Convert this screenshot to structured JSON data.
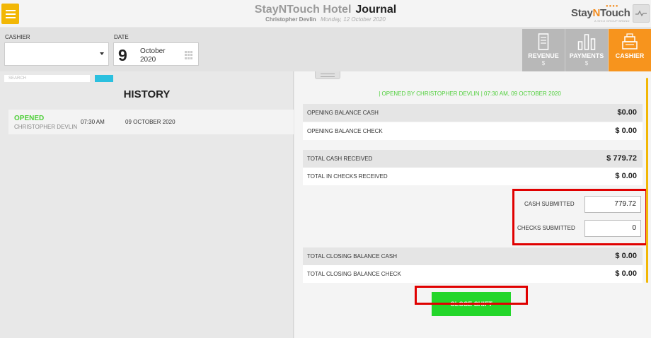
{
  "header": {
    "hotel_name": "StayNTouch Hotel",
    "page_title": "Journal",
    "user_name": "Christopher Devlin",
    "business_date": "Monday, 12 October 2020",
    "logo_text_a": "Stay",
    "logo_text_n": "N",
    "logo_text_b": "Touch",
    "logo_sub": "A SHIJI GROUP BRAND"
  },
  "filters": {
    "cashier_label": "CASHIER",
    "cashier_value": "",
    "date_label": "DATE",
    "date_day": "9",
    "date_month": "October",
    "date_year": "2020"
  },
  "tabs": [
    {
      "label": "REVENUE",
      "sub": "$"
    },
    {
      "label": "PAYMENTS",
      "sub": "$"
    },
    {
      "label": "CASHIER",
      "sub": ""
    }
  ],
  "history": {
    "search_placeholder": "SEARCH",
    "title": "HISTORY",
    "rows": [
      {
        "status": "OPENED",
        "user": "CHRISTOPHER DEVLIN",
        "time": "07:30 AM",
        "date": "09 OCTOBER 2020"
      }
    ]
  },
  "shift": {
    "opened_info": "| OPENED BY CHRISTOPHER DEVLIN | 07:30 AM, 09 OCTOBER 2020",
    "opening_cash_label": "OPENING BALANCE CASH",
    "opening_cash_value": "$0.00",
    "opening_check_label": "OPENING BALANCE CHECK",
    "opening_check_value": "$ 0.00",
    "total_cash_label": "TOTAL CASH RECEIVED",
    "total_cash_value": "$ 779.72",
    "total_checks_label": "TOTAL IN CHECKS RECEIVED",
    "total_checks_value": "$ 0.00",
    "cash_submitted_label": "CASH SUBMITTED",
    "cash_submitted_value": "779.72",
    "checks_submitted_label": "CHECKS SUBMITTED",
    "checks_submitted_value": "0",
    "closing_cash_label": "TOTAL CLOSING BALANCE CASH",
    "closing_cash_value": "$ 0.00",
    "closing_check_label": "TOTAL CLOSING BALANCE CHECK",
    "closing_check_value": "$ 0.00",
    "close_button": "CLOSE SHIFT"
  },
  "colors": {
    "accent_orange": "#f7941d",
    "menu_yellow": "#f2b705",
    "status_green": "#4fcf3a",
    "button_green": "#23d62a",
    "annotation_red": "#e00000"
  }
}
